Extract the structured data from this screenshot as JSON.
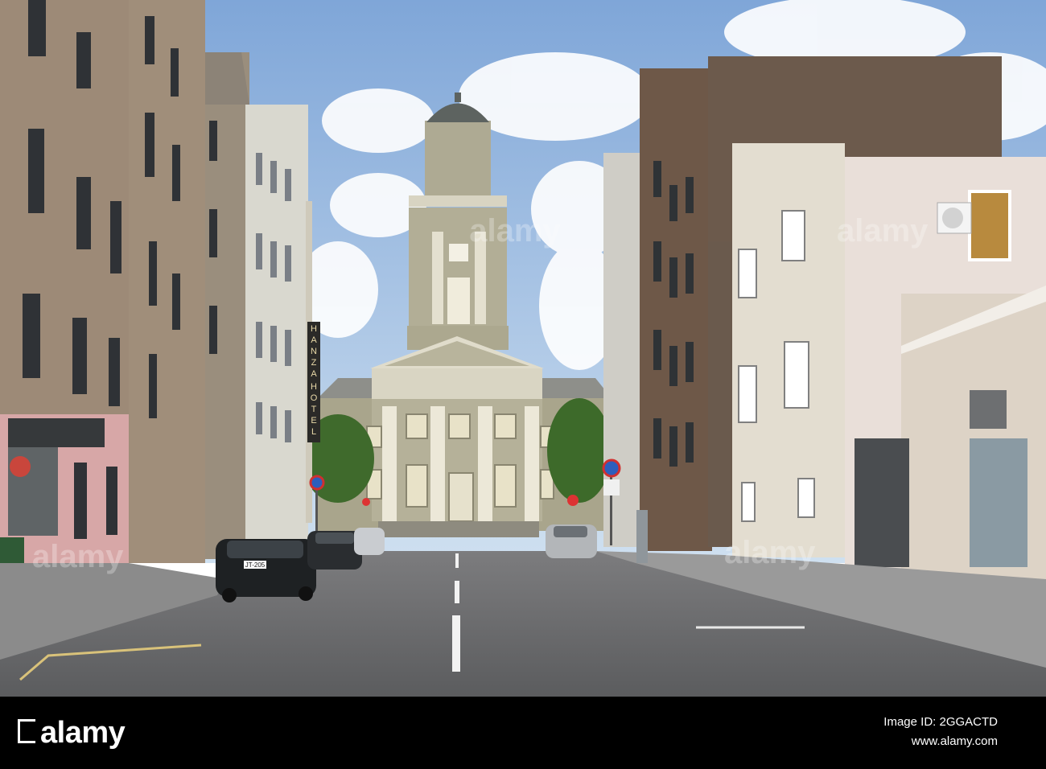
{
  "scene": {
    "description_alt": "Street photo",
    "hotel_sign_letters": [
      "H",
      "A",
      "N",
      "Z",
      "A",
      "H",
      "O",
      "T",
      "E",
      "L"
    ],
    "plate_front_car": "JT-205"
  },
  "watermark": {
    "text": "alamy"
  },
  "footer": {
    "logo": "alamy",
    "image_id_label": "Image ID: 2GGACTD",
    "site": "www.alamy.com"
  },
  "colors": {
    "sky": "#a9c6e6",
    "church": "#b9b39a",
    "footer": "#000000"
  }
}
